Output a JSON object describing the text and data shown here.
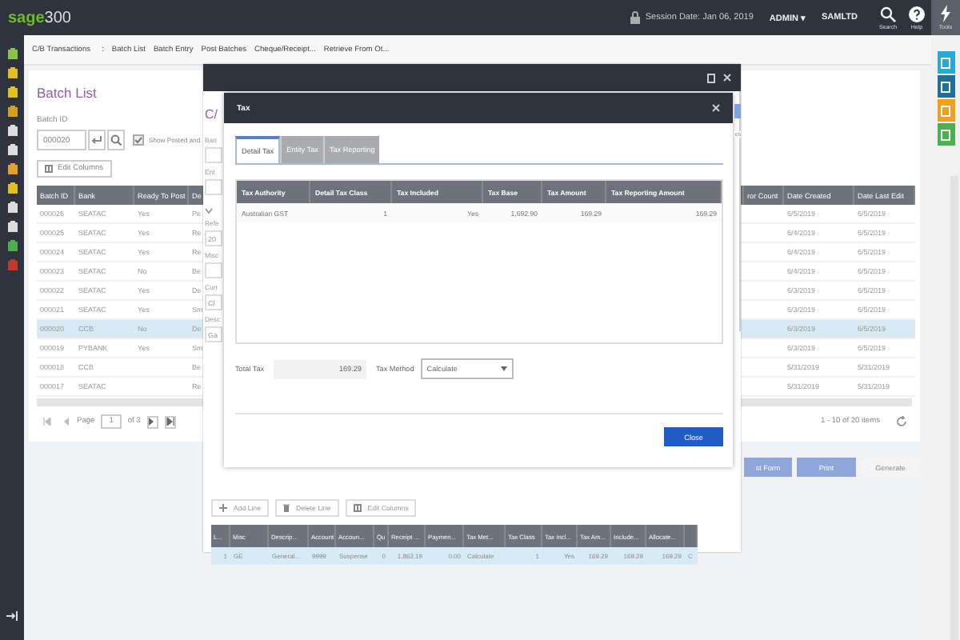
{
  "topbar": {
    "logo_brand": "sage",
    "logo_number": "300",
    "session": "Session Date: Jan 06, 2019",
    "user": "ADMIN",
    "user_caret": "▾",
    "company": "SAMLTD",
    "actions": [
      {
        "label": "Search",
        "kind": "search",
        "selected": false
      },
      {
        "label": "Help",
        "kind": "help",
        "selected": false
      },
      {
        "label": "Tools",
        "kind": "tools",
        "selected": true
      }
    ]
  },
  "breadcrumb": {
    "root": "C/B Transactions",
    "separator": ":",
    "links": [
      "Batch List",
      "Batch Entry",
      "Post Batches",
      "Cheque/Receipt...",
      "Retrieve From Ot..."
    ]
  },
  "batch_list": {
    "title": "Batch List",
    "batch_id_label": "Batch ID",
    "batch_id_value": "000020",
    "show_posted": {
      "label": "Show Posted and",
      "checked": true
    },
    "edit_columns": "Edit Columns",
    "left_columns": [
      "Batch ID",
      "Bank",
      "Ready To Post",
      "De"
    ],
    "right_columns": [
      "ror Count",
      "Date Created",
      "Date Last Edit"
    ],
    "rows": [
      {
        "batch_id": "000026",
        "bank": "SEATAC",
        "ready_to_post": "Yes",
        "description": "Pe",
        "date_created": "6/5/2019",
        "date_last_edit": "6/5/2019",
        "selected": false
      },
      {
        "batch_id": "000025",
        "bank": "SEATAC",
        "ready_to_post": "Yes",
        "description": "Re",
        "date_created": "6/4/2019",
        "date_last_edit": "6/5/2019",
        "selected": false
      },
      {
        "batch_id": "000024",
        "bank": "SEATAC",
        "ready_to_post": "Yes",
        "description": "Re",
        "date_created": "6/4/2019",
        "date_last_edit": "6/5/2019",
        "selected": false
      },
      {
        "batch_id": "000023",
        "bank": "SEATAC",
        "ready_to_post": "No",
        "description": "Be",
        "date_created": "6/4/2019",
        "date_last_edit": "6/5/2019",
        "selected": false
      },
      {
        "batch_id": "000022",
        "bank": "SEATAC",
        "ready_to_post": "Yes",
        "description": "De",
        "date_created": "6/3/2019",
        "date_last_edit": "6/5/2019",
        "selected": false
      },
      {
        "batch_id": "000021",
        "bank": "SEATAC",
        "ready_to_post": "Yes",
        "description": "Sm",
        "date_created": "6/3/2019",
        "date_last_edit": "6/5/2019",
        "selected": false
      },
      {
        "batch_id": "000020",
        "bank": "CCB",
        "ready_to_post": "No",
        "description": "De",
        "date_created": "6/3/2019",
        "date_last_edit": "6/5/2019",
        "selected": true
      },
      {
        "batch_id": "000019",
        "bank": "PYBANK",
        "ready_to_post": "Yes",
        "description": "Sm",
        "date_created": "6/3/2019",
        "date_last_edit": "6/5/2019",
        "selected": false
      },
      {
        "batch_id": "000018",
        "bank": "CCB",
        "description": "Be",
        "date_created": "5/31/2019",
        "date_last_edit": "5/31/2019",
        "selected": false
      },
      {
        "batch_id": "000017",
        "bank": "SEATAC",
        "description": "Re",
        "date_created": "5/31/2019",
        "date_last_edit": "5/31/2019",
        "selected": false
      }
    ],
    "pager": {
      "page_label": "Page",
      "page": "1",
      "of": "of 3",
      "summary": "1 - 10 of 20 items"
    },
    "buttons": [
      {
        "label": "st Form",
        "disabled": false
      },
      {
        "label": "Print",
        "disabled": false
      },
      {
        "label": "Generate",
        "disabled": true
      }
    ]
  },
  "entry_window": {
    "title_fragment": "C/",
    "side_fragment": "es",
    "form_fragments": [
      {
        "label": "Ban"
      },
      {
        "label": "Ent"
      },
      {
        "label": "Refe",
        "value": "20"
      },
      {
        "label": "Misc"
      },
      {
        "label": "Curr",
        "value": "Cl"
      },
      {
        "label": "Desc",
        "value": "Ga"
      }
    ],
    "detail_buttons": [
      "Add Line",
      "Delete Line",
      "Edit Columns"
    ],
    "detail_columns": [
      "L...",
      "Misc",
      "Descrip...",
      "Account",
      "Accoun...",
      "Qu",
      "Receipt ...",
      "Paymen...",
      "Tax Met...",
      "Tax Class",
      "Tax Incl...",
      "Tax Am...",
      "Include...",
      "Allocate..."
    ],
    "detail_rows": [
      {
        "cells": [
          "1",
          "GE",
          "General...",
          "9999",
          "Suspense",
          "0",
          "1,862.19",
          "0.00",
          "Calculate",
          "1",
          "Yes",
          "169.29",
          "169.29",
          "169.29",
          "C"
        ],
        "selected": true
      }
    ]
  },
  "tax_dialog": {
    "title": "Tax",
    "tabs": [
      {
        "label": "Detail Tax",
        "selected": true
      },
      {
        "label": "Entity Tax",
        "selected": false
      },
      {
        "label": "Tax Reporting",
        "selected": false
      }
    ],
    "columns": [
      "Tax Authority",
      "Detail Tax Class",
      "Tax Included",
      "Tax Base",
      "Tax Amount",
      "Tax Reporting Amount"
    ],
    "rows": [
      {
        "cells": [
          "Australian GST",
          "1",
          "Yes",
          "1,692.90",
          "169.29",
          "169.29"
        ]
      }
    ],
    "total_tax_label": "Total Tax",
    "total_tax": "169.29",
    "tax_method_label": "Tax Method",
    "tax_method": "Calculate",
    "close": "Close"
  }
}
